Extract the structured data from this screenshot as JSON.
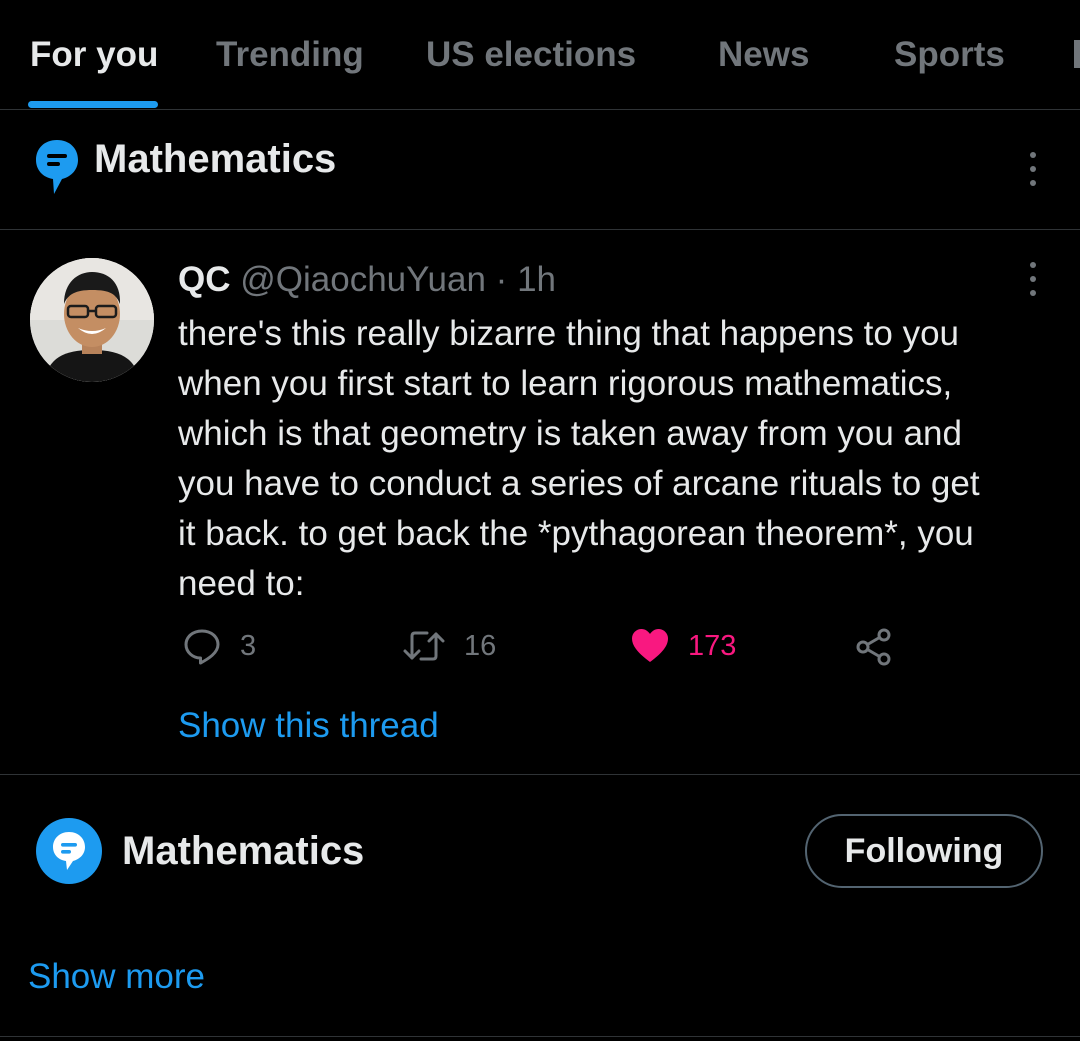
{
  "tabs": [
    {
      "label": "For you",
      "active": true
    },
    {
      "label": "Trending",
      "active": false
    },
    {
      "label": "US elections",
      "active": false
    },
    {
      "label": "News",
      "active": false
    },
    {
      "label": "Sports",
      "active": false
    }
  ],
  "topic_header": {
    "title": "Mathematics",
    "icon": "topic-speech-bubble-icon",
    "more_icon": "more-vertical-icon"
  },
  "tweet": {
    "display_name": "QC",
    "handle": "@QiaochuYuan",
    "separator": "·",
    "time": "1h",
    "text": "there's this really bizarre thing that happens to you\nwhen you first start to learn rigorous mathematics,\nwhich is that geometry is taken away from you and\nyou have to conduct a series of arcane rituals to get\nit back. to get back the *pythagorean theorem*, you\nneed to:",
    "replies": "3",
    "retweets": "16",
    "likes": "173",
    "liked": true,
    "show_thread_label": "Show this thread"
  },
  "topic_row": {
    "title": "Mathematics",
    "button_label": "Following"
  },
  "show_more_label": "Show more",
  "colors": {
    "accent": "#1d9bf0",
    "like": "#f91880",
    "muted": "#71767b",
    "text": "#e7e9ea",
    "border": "#2f3336",
    "background": "#000000"
  }
}
